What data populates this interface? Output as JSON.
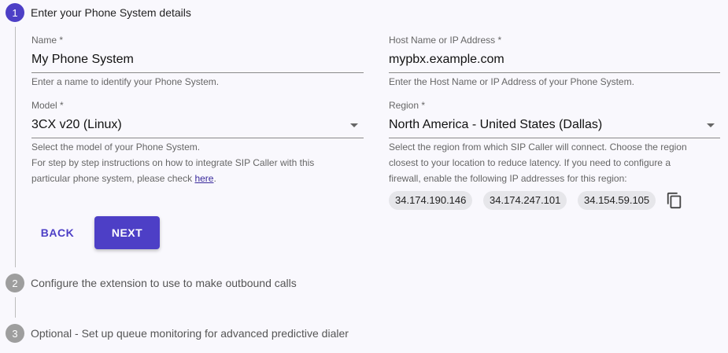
{
  "steps": [
    {
      "number": "1",
      "title": "Enter your Phone System details"
    },
    {
      "number": "2",
      "title": "Configure the extension to use to make outbound calls"
    },
    {
      "number": "3",
      "title": "Optional - Set up queue monitoring for advanced predictive dialer"
    }
  ],
  "form": {
    "name": {
      "label": "Name *",
      "value": "My Phone System",
      "helper": "Enter a name to identify your Phone System."
    },
    "host": {
      "label": "Host Name or IP Address *",
      "value": "mypbx.example.com",
      "helper": "Enter the Host Name or IP Address of your Phone System."
    },
    "model": {
      "label": "Model *",
      "value": "3CX v20 (Linux)",
      "helper_line1": "Select the model of your Phone System.",
      "helper_line2": "For step by step instructions on how to integrate SIP Caller with this",
      "helper_line3_prefix": "particular phone system, please check ",
      "helper_link": "here",
      "helper_line3_suffix": "."
    },
    "region": {
      "label": "Region *",
      "value": "North America - United States (Dallas)",
      "helper_line1": "Select the region from which SIP Caller will connect. Choose the region",
      "helper_line2": "closest to your location to reduce latency. If you need to configure a",
      "helper_line3": "firewall, enable the following IP addresses for this region:",
      "ips": [
        "34.174.190.146",
        "34.174.247.101",
        "34.154.59.105"
      ]
    }
  },
  "buttons": {
    "back": "BACK",
    "next": "NEXT"
  },
  "icons": {
    "copy": "copy-icon",
    "dropdown": "arrow-drop-down-icon"
  },
  "colors": {
    "accent": "#4d3fc6",
    "inactive_step": "#9e9e9e",
    "background": "#f9f8fd"
  }
}
